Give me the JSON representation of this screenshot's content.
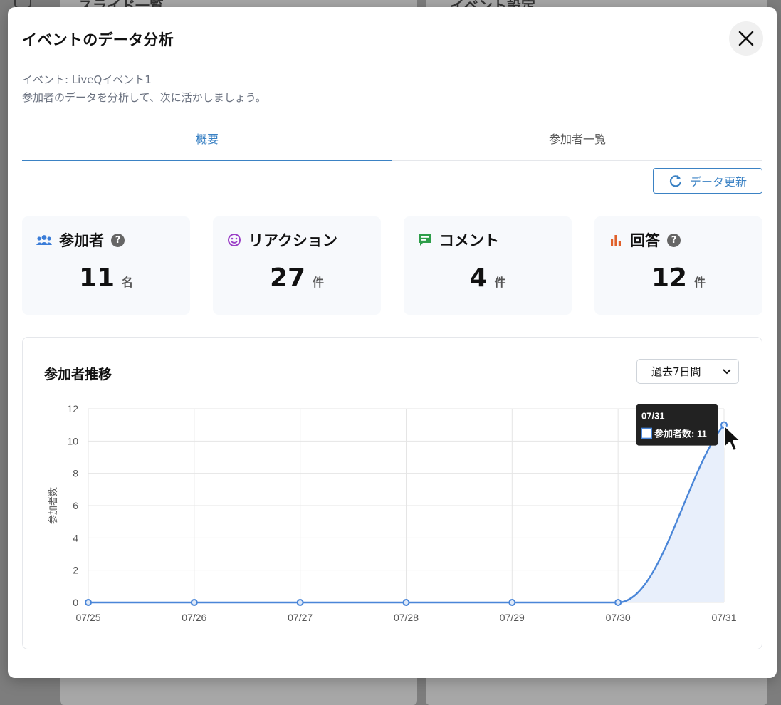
{
  "background": {
    "left_panel_title": "スライド一覧",
    "right_panel_title": "イベント設定"
  },
  "modal": {
    "title": "イベントのデータ分析",
    "event_line": "イベント: LiveQイベント1",
    "description": "参加者のデータを分析して、次に活かしましょう。"
  },
  "tabs": [
    {
      "label": "概要",
      "active": true
    },
    {
      "label": "参加者一覧",
      "active": false
    }
  ],
  "refresh_button": {
    "label": "データ更新",
    "icon": "refresh-icon"
  },
  "stats": [
    {
      "label": "参加者",
      "value": "11",
      "unit": "名",
      "icon": "people-icon",
      "color": "#3b7dd8",
      "help": true
    },
    {
      "label": "リアクション",
      "value": "27",
      "unit": "件",
      "icon": "smile-icon",
      "color": "#9b3fc7",
      "help": false
    },
    {
      "label": "コメント",
      "value": "4",
      "unit": "件",
      "icon": "comment-icon",
      "color": "#2e9e4a",
      "help": false
    },
    {
      "label": "回答",
      "value": "12",
      "unit": "件",
      "icon": "bar-chart-icon",
      "color": "#e0602a",
      "help": true
    }
  ],
  "help_glyph": "?",
  "trend_card": {
    "title": "参加者推移",
    "range_select": "過去7日間"
  },
  "chart_data": {
    "type": "line",
    "categories": [
      "07/25",
      "07/26",
      "07/27",
      "07/28",
      "07/29",
      "07/30",
      "07/31"
    ],
    "series": [
      {
        "name": "参加者数",
        "values": [
          0,
          0,
          0,
          0,
          0,
          0,
          11
        ],
        "color": "#4a86d8"
      }
    ],
    "ylabel": "参加者数",
    "ylim": [
      0,
      12
    ],
    "yticks": [
      0,
      2,
      4,
      6,
      8,
      10,
      12
    ],
    "grid": true,
    "fill": true,
    "tooltip": {
      "title": "07/31",
      "label": "参加者数: 11"
    }
  }
}
